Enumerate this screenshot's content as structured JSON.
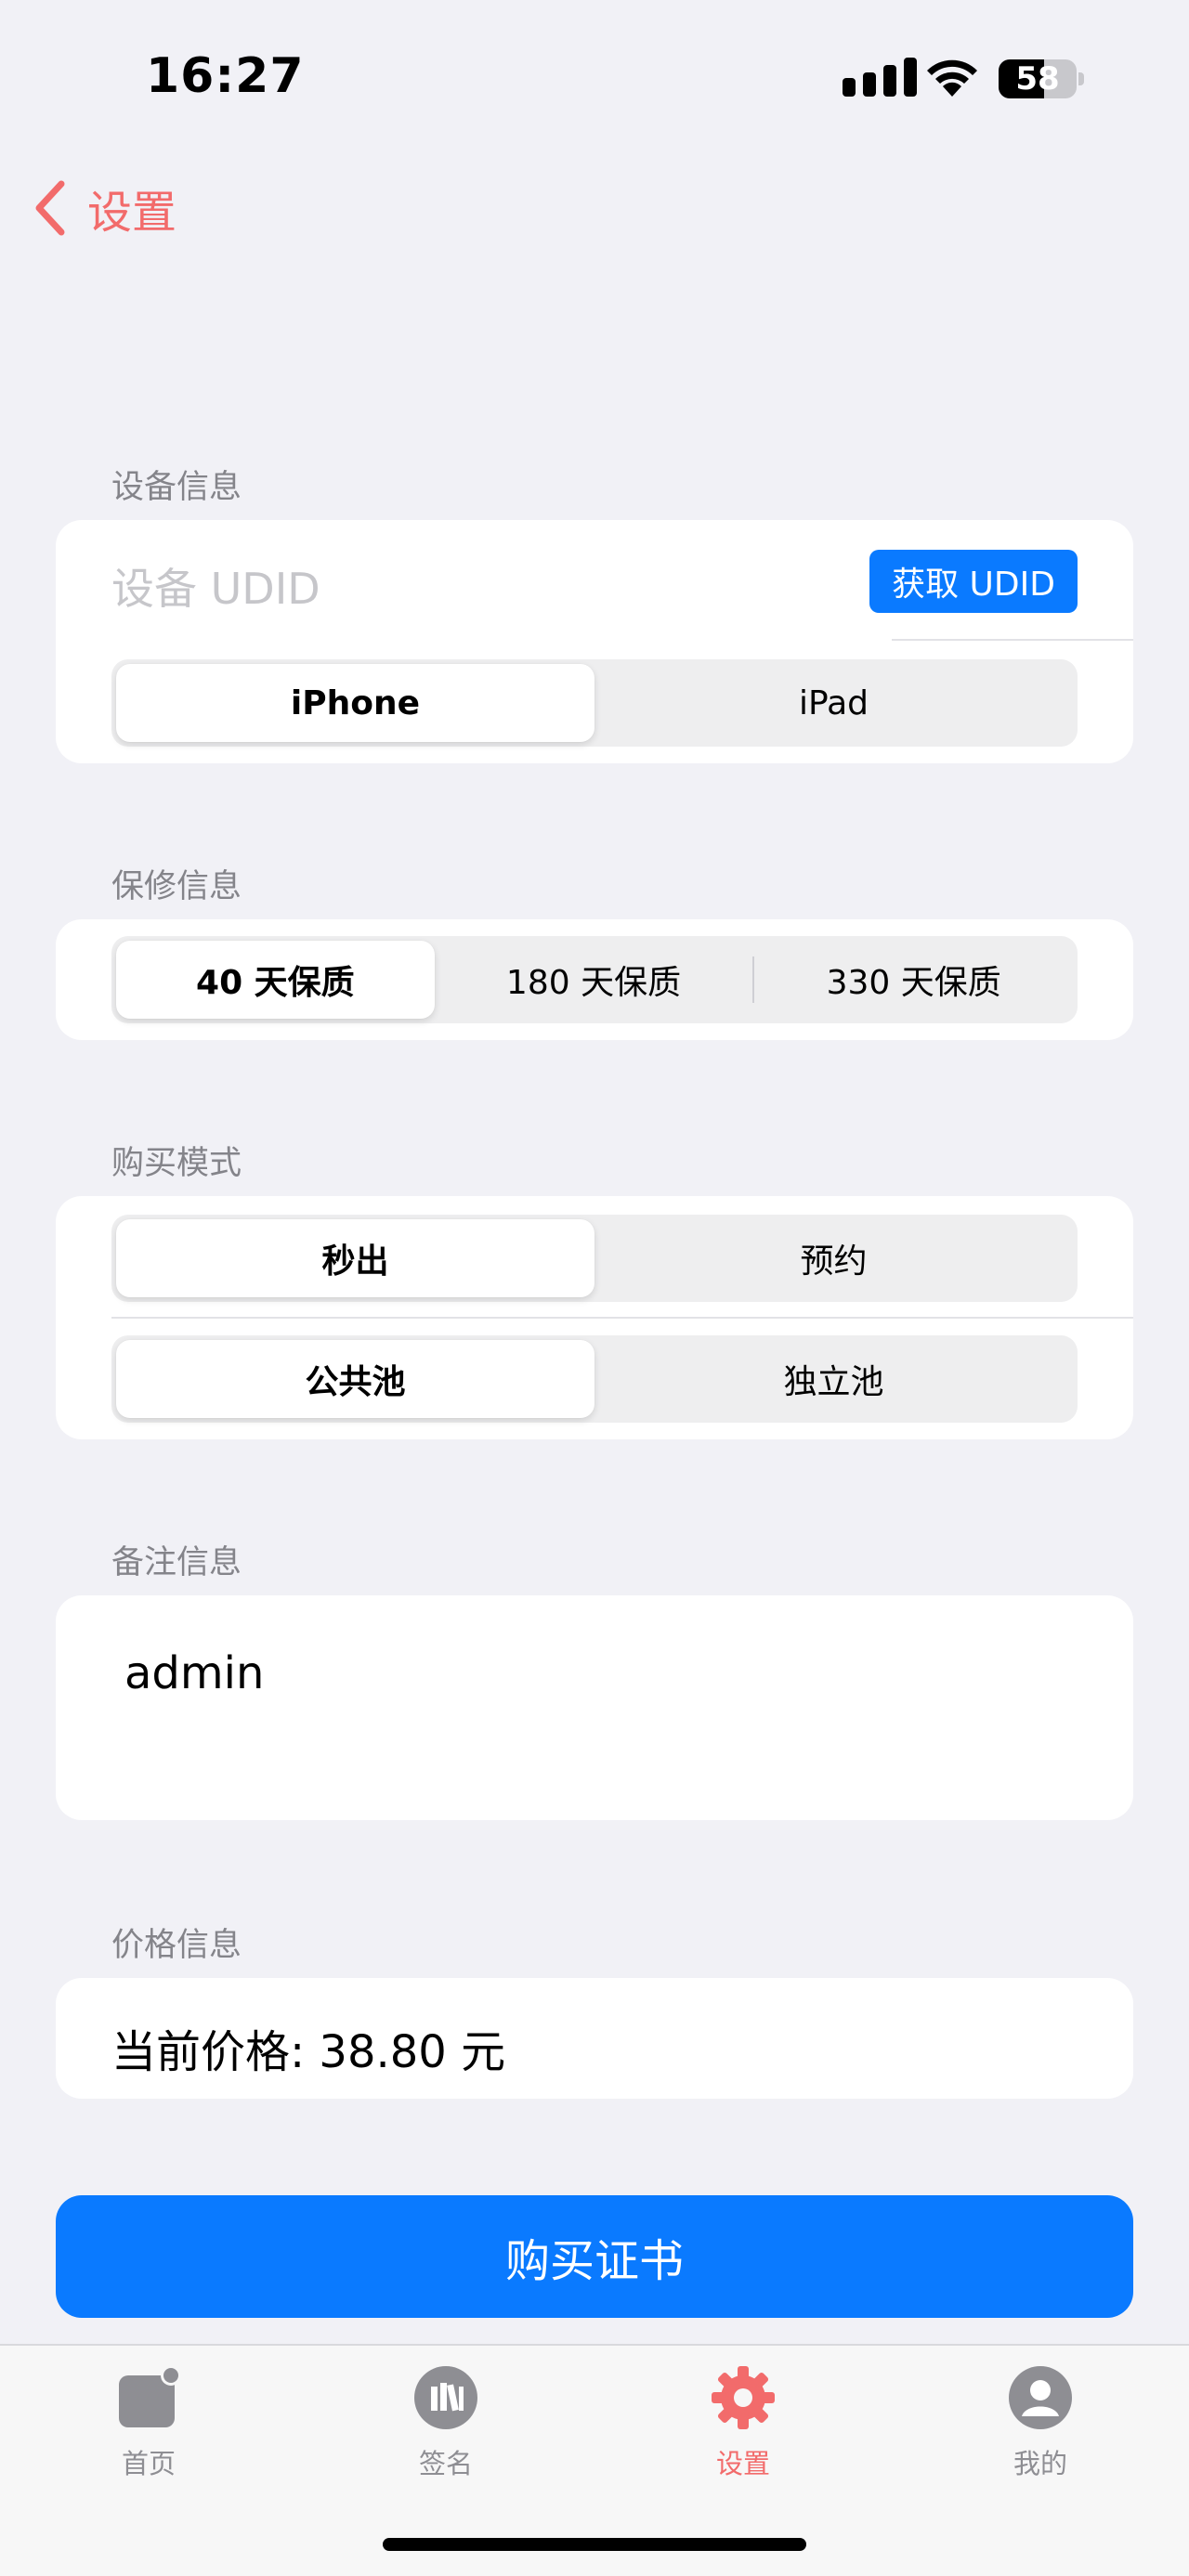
{
  "status_bar": {
    "time": "16:27",
    "battery": "58",
    "battery_level": 0.58
  },
  "nav": {
    "back_label": "设置"
  },
  "device": {
    "section_label": "设备信息",
    "udid_placeholder": "设备 UDID",
    "get_udid_label": "获取 UDID",
    "types": [
      "iPhone",
      "iPad"
    ],
    "selected": 0
  },
  "warranty": {
    "section_label": "保修信息",
    "options": [
      "40 天保质",
      "180 天保质",
      "330 天保质"
    ],
    "selected": 0
  },
  "purchase_mode": {
    "section_label": "购买模式",
    "speed": [
      "秒出",
      "预约"
    ],
    "speed_selected": 0,
    "pool": [
      "公共池",
      "独立池"
    ],
    "pool_selected": 0
  },
  "note": {
    "section_label": "备注信息",
    "value": "admin"
  },
  "price": {
    "section_label": "价格信息",
    "text": "当前价格: 38.80 元"
  },
  "buy_button": {
    "label": "购买证书"
  },
  "tabs": [
    {
      "label": "首页",
      "icon": "home-icon"
    },
    {
      "label": "签名",
      "icon": "library-icon"
    },
    {
      "label": "设置",
      "icon": "gear-icon",
      "active": true
    },
    {
      "label": "我的",
      "icon": "person-icon"
    }
  ],
  "colors": {
    "accent": "#F26B6B",
    "button_blue": "#0A7AFF",
    "background": "#F1F1F6"
  }
}
